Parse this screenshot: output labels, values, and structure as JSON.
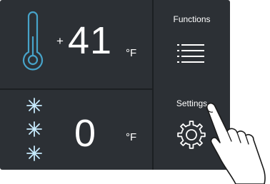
{
  "fridge": {
    "sign": "+",
    "temperature": "41",
    "unit": "°F",
    "icon": "thermometer-icon"
  },
  "freezer": {
    "temperature": "0",
    "unit": "°F",
    "icon": "snowflake-icon"
  },
  "functions": {
    "label": "Functions",
    "icon": "list-icon"
  },
  "settings": {
    "label": "Settings",
    "icon": "gear-icon"
  },
  "colors": {
    "panel": "#2c3035",
    "text": "#ffffff",
    "accent": "#47a3c9",
    "snowflake": "#c8ecff"
  }
}
